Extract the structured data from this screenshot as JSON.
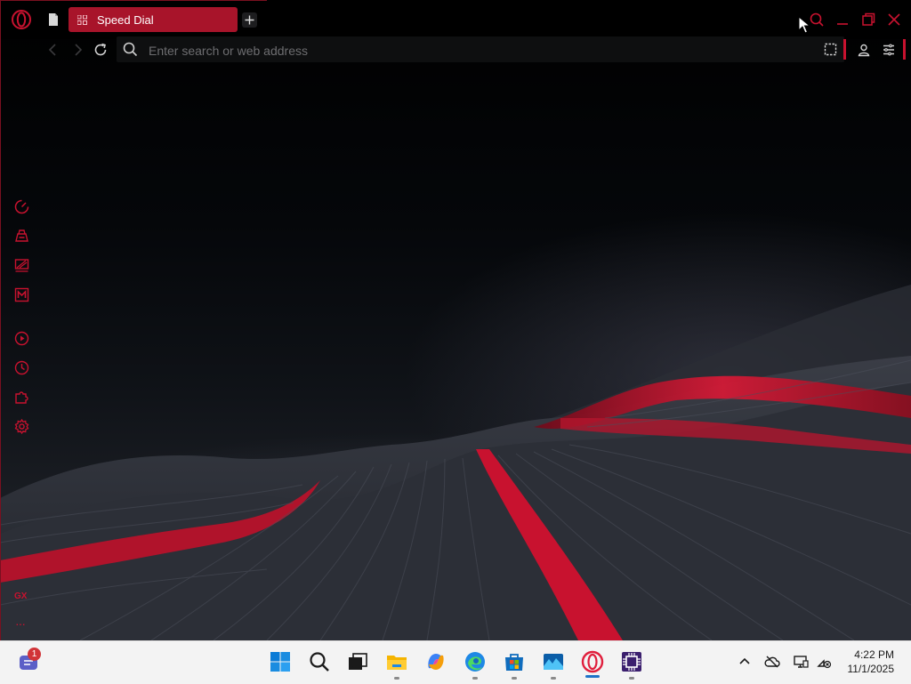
{
  "browser": {
    "tab_title": "Speed Dial",
    "address_placeholder": "Enter search or web address",
    "sidebar_text": "GX",
    "sidebar_more": "···"
  },
  "icons": {
    "titlebar": [
      "opera-logo-icon",
      "page-icon",
      "speed-dial-grid-icon",
      "new-tab-plus-icon",
      "search-icon",
      "minimize-icon",
      "restore-icon",
      "close-icon"
    ],
    "navbar": [
      "back-arrow-icon",
      "forward-arrow-icon",
      "reload-icon",
      "search-icon",
      "snapshot-icon",
      "account-icon",
      "easy-setup-icon"
    ],
    "sidebar": [
      "gx-control-icon",
      "gx-corner-icon",
      "twitch-icon",
      "gmail-icon",
      "player-icon",
      "history-icon",
      "extensions-icon",
      "settings-icon"
    ],
    "taskbar": [
      "notification-app-icon",
      "start-icon",
      "search-icon",
      "task-view-icon",
      "file-explorer-icon",
      "copilot-icon",
      "edge-icon",
      "store-icon",
      "photos-icon",
      "opera-icon",
      "cpu-app-icon"
    ],
    "tray": [
      "chevron-up-icon",
      "onedrive-icon",
      "display-icon",
      "network-icon"
    ]
  },
  "taskbar": {
    "notification_count": "1",
    "time": "4:22 PM",
    "date": "11/1/2025"
  },
  "colors": {
    "accent": "#c8122f",
    "tab_active": "#a8142a",
    "taskbar_bg": "#f3f3f3",
    "titlebar_bg": "#000000"
  }
}
